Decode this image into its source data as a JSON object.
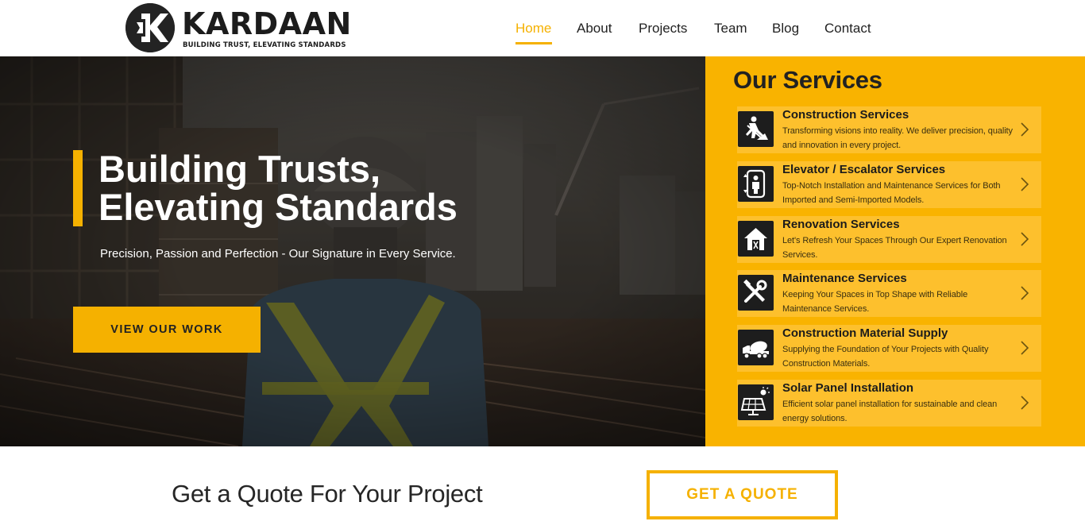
{
  "brand": {
    "name": "KARDAAN",
    "tagline": "BUILDING TRUST, ELEVATING STANDARDS",
    "accent": "#f5b100"
  },
  "nav": {
    "items": [
      {
        "label": "Home",
        "active": true
      },
      {
        "label": "About"
      },
      {
        "label": "Projects"
      },
      {
        "label": "Team"
      },
      {
        "label": "Blog"
      },
      {
        "label": "Contact"
      }
    ]
  },
  "hero": {
    "title_line1": "Building Trusts,",
    "title_line2": "Elevating Standards",
    "subtitle": "Precision, Passion and Perfection - Our Signature in Every Service.",
    "cta_label": "VIEW OUR WORK"
  },
  "services": {
    "heading": "Our Services",
    "items": [
      {
        "title": "Construction Services",
        "desc": "Transforming visions into reality. We deliver precision, quality and innovation in every project.",
        "icon": "worker-digging-icon"
      },
      {
        "title": "Elevator / Escalator Services",
        "desc": "Top-Notch Installation and Maintenance Services for Both Imported and Semi-Imported Models.",
        "icon": "elevator-icon"
      },
      {
        "title": "Renovation Services",
        "desc": "Let's Refresh Your Spaces Through Our Expert Renovation Services.",
        "icon": "house-tools-icon"
      },
      {
        "title": "Maintenance Services",
        "desc": "Keeping Your Spaces in Top Shape with Reliable Maintenance Services.",
        "icon": "wrench-hammer-icon"
      },
      {
        "title": "Construction Material Supply",
        "desc": "Supplying the Foundation of Your Projects with Quality Construction Materials.",
        "icon": "cement-truck-icon"
      },
      {
        "title": "Solar Panel Installation",
        "desc": "Efficient solar panel installation for sustainable and clean energy solutions.",
        "icon": "solar-panel-icon"
      }
    ]
  },
  "quote": {
    "text": "Get a Quote For Your Project",
    "button_label": "GET A QUOTE"
  }
}
